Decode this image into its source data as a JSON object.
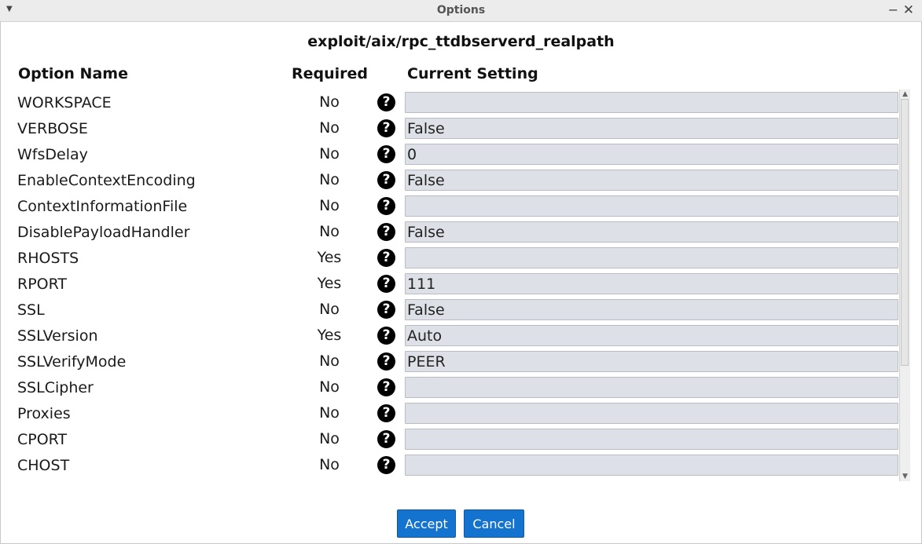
{
  "window": {
    "title": "Options",
    "menu_icon": "chevron-down-icon",
    "minimize_icon": "minimize-icon",
    "close_icon": "close-icon"
  },
  "module_title": "exploit/aix/rpc_ttdbserverd_realpath",
  "headers": {
    "name": "Option Name",
    "required": "Required",
    "setting": "Current Setting"
  },
  "help_glyph": "?",
  "options": [
    {
      "name": "WORKSPACE",
      "required": "No",
      "value": ""
    },
    {
      "name": "VERBOSE",
      "required": "No",
      "value": "False"
    },
    {
      "name": "WfsDelay",
      "required": "No",
      "value": "0"
    },
    {
      "name": "EnableContextEncoding",
      "required": "No",
      "value": "False"
    },
    {
      "name": "ContextInformationFile",
      "required": "No",
      "value": ""
    },
    {
      "name": "DisablePayloadHandler",
      "required": "No",
      "value": "False"
    },
    {
      "name": "RHOSTS",
      "required": "Yes",
      "value": ""
    },
    {
      "name": "RPORT",
      "required": "Yes",
      "value": "111"
    },
    {
      "name": "SSL",
      "required": "No",
      "value": "False"
    },
    {
      "name": "SSLVersion",
      "required": "Yes",
      "value": "Auto"
    },
    {
      "name": "SSLVerifyMode",
      "required": "No",
      "value": "PEER"
    },
    {
      "name": "SSLCipher",
      "required": "No",
      "value": ""
    },
    {
      "name": "Proxies",
      "required": "No",
      "value": ""
    },
    {
      "name": "CPORT",
      "required": "No",
      "value": ""
    },
    {
      "name": "CHOST",
      "required": "No",
      "value": ""
    }
  ],
  "buttons": {
    "accept": "Accept",
    "cancel": "Cancel"
  },
  "colors": {
    "button_bg": "#1473cf",
    "field_bg": "#dde1e7"
  }
}
